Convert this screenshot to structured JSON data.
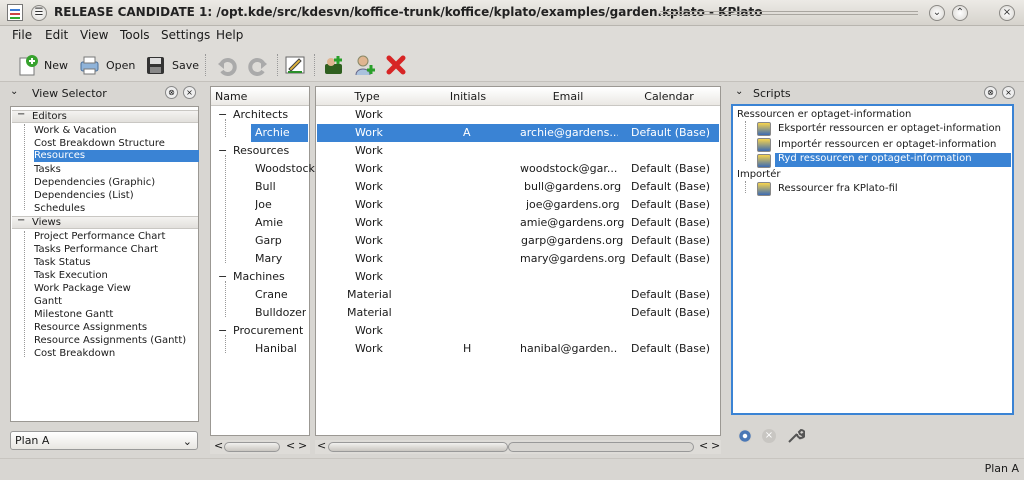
{
  "window": {
    "title": "RELEASE CANDIDATE 1: /opt.kde/src/kdesvn/koffice-trunk/koffice/kplato/examples/garden.kplato - KPlato",
    "menu_glyph": "☰",
    "close_glyph": "×",
    "minimize_glyph": "⌄",
    "maximize_glyph": "⌃",
    "window_close_glyph": "×"
  },
  "menubar": {
    "items": [
      "File",
      "Edit",
      "View",
      "Tools",
      "Settings",
      "Help"
    ]
  },
  "toolbar": {
    "new_label": "New",
    "open_label": "Open",
    "save_label": "Save"
  },
  "view_selector": {
    "title": "View Selector",
    "toggle_glyph": "⊗",
    "close_glyph": "×",
    "sections": [
      {
        "title": "Editors",
        "items": [
          "Work & Vacation",
          "Cost Breakdown Structure",
          "Resources",
          "Tasks",
          "Dependencies (Graphic)",
          "Dependencies (List)",
          "Schedules"
        ]
      },
      {
        "title": "Views",
        "items": [
          "Project Performance Chart",
          "Tasks Performance Chart",
          "Task Status",
          "Task Execution",
          "Work Package View",
          "Gantt",
          "Milestone Gantt",
          "Resource Assignments",
          "Resource Assignments (Gantt)",
          "Cost Breakdown"
        ]
      }
    ],
    "selected_item": "Resources",
    "plan": "Plan A"
  },
  "resource_tree": {
    "header": "Name",
    "groups": [
      {
        "name": "Architects",
        "expanded": true,
        "items": [
          "Archie"
        ]
      },
      {
        "name": "Resources",
        "expanded": true,
        "items": [
          "Woodstock",
          "Bull",
          "Joe",
          "Amie",
          "Garp",
          "Mary"
        ]
      },
      {
        "name": "Machines",
        "expanded": true,
        "items": [
          "Crane",
          "Bulldozer"
        ]
      },
      {
        "name": "Procurement",
        "expanded": true,
        "items": [
          "Hanibal"
        ]
      }
    ],
    "selected": "Archie"
  },
  "resource_table": {
    "columns": [
      "Type",
      "Initials",
      "Email",
      "Calendar"
    ],
    "rows": [
      [
        "Work",
        "",
        "",
        ""
      ],
      [
        "Work",
        "A",
        "archie@gardens....",
        "Default (Base)"
      ],
      [
        "Work",
        "",
        "",
        ""
      ],
      [
        "Work",
        "",
        "woodstock@gar...",
        "Default (Base)"
      ],
      [
        "Work",
        "",
        "bull@gardens.org",
        "Default (Base)"
      ],
      [
        "Work",
        "",
        "joe@gardens.org",
        "Default (Base)"
      ],
      [
        "Work",
        "",
        "amie@gardens.org",
        "Default (Base)"
      ],
      [
        "Work",
        "",
        "garp@gardens.org",
        "Default (Base)"
      ],
      [
        "Work",
        "",
        "mary@gardens.org",
        "Default (Base)"
      ],
      [
        "Work",
        "",
        "",
        ""
      ],
      [
        "Material",
        "",
        "",
        "Default (Base)"
      ],
      [
        "Material",
        "",
        "",
        "Default (Base)"
      ],
      [
        "Work",
        "",
        "",
        ""
      ],
      [
        "Work",
        "H",
        "hanibal@garden...",
        "Default (Base)"
      ]
    ]
  },
  "scripts": {
    "title": "Scripts",
    "groups": [
      {
        "title": "Ressourcen er optaget-information",
        "items": [
          "Eksportér ressourcen er optaget-information",
          "Importér ressourcen er optaget-information",
          "Ryd ressourcen er optaget-information"
        ]
      },
      {
        "title": "Importér",
        "items": [
          "Ressourcer fra KPlato-fil"
        ]
      }
    ],
    "selected": "Ryd ressourcen er optaget-information"
  },
  "status": {
    "text": "Plan A"
  },
  "scroll": {
    "left_arrow": "<",
    "right_arrow": ">",
    "inner_left": "<",
    "inner_right": ">"
  }
}
